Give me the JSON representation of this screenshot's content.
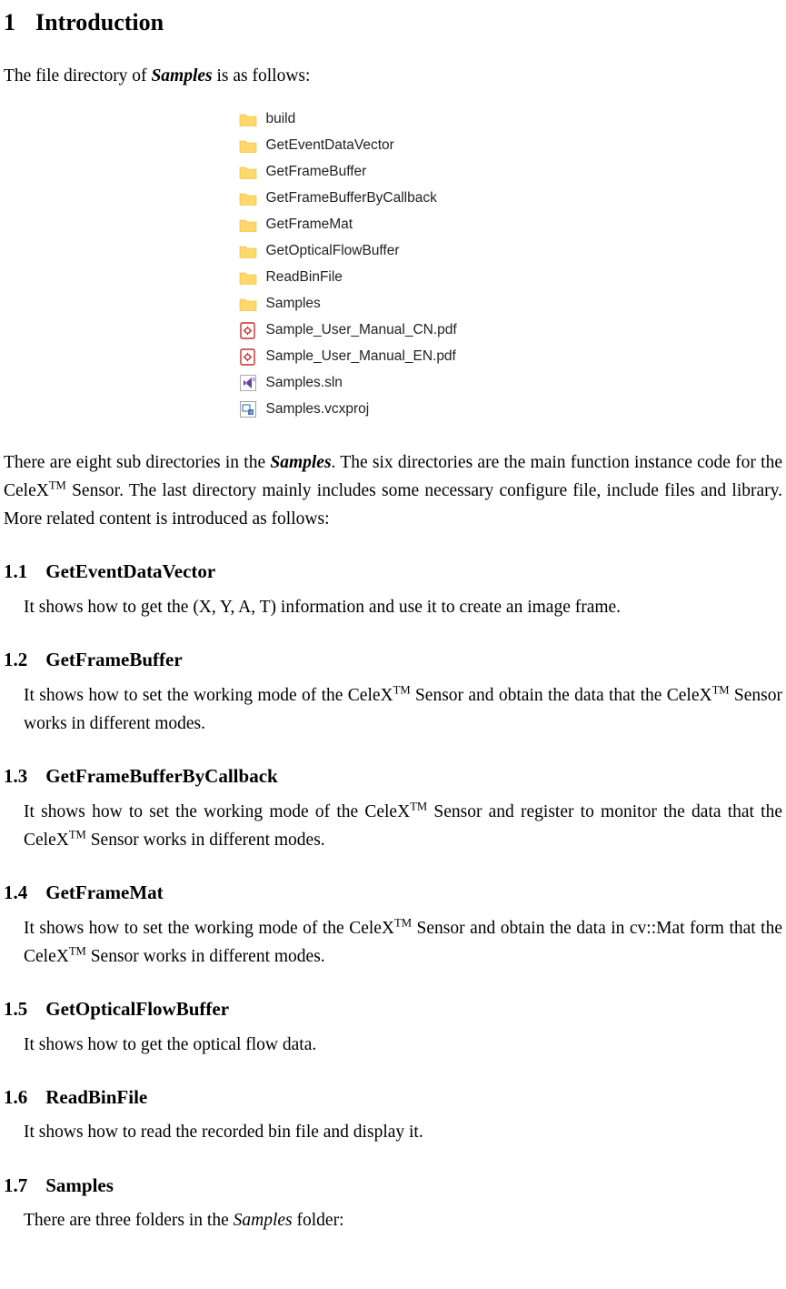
{
  "section": {
    "num": "1",
    "title": "Introduction"
  },
  "intro_before": "The file directory of ",
  "intro_em": "Samples",
  "intro_after": " is as follows:",
  "files": {
    "f0": "build",
    "f1": "GetEventDataVector",
    "f2": "GetFrameBuffer",
    "f3": "GetFrameBufferByCallback",
    "f4": "GetFrameMat",
    "f5": "GetOpticalFlowBuffer",
    "f6": "ReadBinFile",
    "f7": "Samples",
    "f8": "Sample_User_Manual_CN.pdf",
    "f9": "Sample_User_Manual_EN.pdf",
    "f10": "Samples.sln",
    "f11": "Samples.vcxproj"
  },
  "desc_before": "There are eight sub directories in the ",
  "desc_em": "Samples",
  "desc_after1": ". The six directories are the main function instance code for the CeleX",
  "desc_tm": "TM",
  "desc_after2": " Sensor. The last directory mainly includes some necessary configure file, include files and library. More related content is introduced as follows:",
  "subs": {
    "s1": {
      "num": "1.1",
      "title": "GetEventDataVector",
      "body": "It shows how to get the (X, Y, A, T) information and use it to create an image frame."
    },
    "s2": {
      "num": "1.2",
      "title": "GetFrameBuffer",
      "b1": "It shows how to set the working mode of the CeleX",
      "b2": " Sensor and obtain the data that the CeleX",
      "b3": " Sensor works in different modes."
    },
    "s3": {
      "num": "1.3",
      "title": "GetFrameBufferByCallback",
      "b1": "It shows how to set the working mode of the CeleX",
      "b2": " Sensor and register to monitor the data that the CeleX",
      "b3": " Sensor works in different modes."
    },
    "s4": {
      "num": "1.4",
      "title": "GetFrameMat",
      "b1": "It shows how to set the working mode of the CeleX",
      "b2": " Sensor and obtain the data in cv::Mat form that the CeleX",
      "b3": " Sensor works in different modes."
    },
    "s5": {
      "num": "1.5",
      "title": "GetOpticalFlowBuffer",
      "body": "It shows how to get the optical flow data."
    },
    "s6": {
      "num": "1.6",
      "title": "ReadBinFile",
      "body": "It shows how to read the recorded bin file and display it."
    },
    "s7": {
      "num": "1.7",
      "title": "Samples",
      "b1": "There are three folders in the ",
      "em": "Samples",
      "b2": " folder:"
    }
  }
}
